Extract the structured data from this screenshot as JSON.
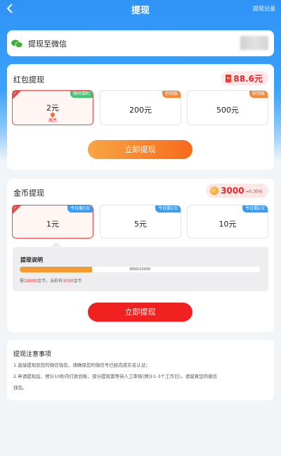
{
  "nav": {
    "title": "提现",
    "record_label": "提现记录"
  },
  "wechat": {
    "label": "提现至微信"
  },
  "red_packet": {
    "title": "红包提现",
    "balance": "88.6元",
    "options": [
      {
        "value": "2元",
        "tag": "限时福利",
        "hint": "高亮",
        "selected": true
      },
      {
        "value": "200元",
        "tag": "秒到账"
      },
      {
        "value": "500元",
        "tag": "秒到账"
      }
    ],
    "button_label": "立即提现"
  },
  "gold": {
    "title": "金币提现",
    "balance": "3000",
    "balance_sub": "≈0.30元",
    "options": [
      {
        "value": "1元",
        "tag": "今日剩3次",
        "selected": true
      },
      {
        "value": "5元",
        "tag": "今日剩2次"
      },
      {
        "value": "10元",
        "tag": "今日剩2次"
      }
    ],
    "note": {
      "title": "提现说明",
      "progress": 0.3,
      "progress_text": "3000/10000",
      "need_prefix": "需",
      "need_amount": "10000",
      "need_mid": "金币，当前有",
      "have_amount": "3030",
      "need_suffix": "金币"
    },
    "button_label": "立即提现"
  },
  "tips": {
    "title": "提现注意事项",
    "lines": [
      "1.直接提现到您的微信钱包，请确保您的微信号已经完成实名认证；",
      "2.申请提现后，预计10秒内打款到账，部分提现需等待人工审核(预计1-3个工作日)，请留意您的微信",
      "钱包。"
    ]
  },
  "colors": {
    "primary_blue": "#2f93f6",
    "accent_red": "#e8262c",
    "orange": "#f76a1c",
    "wechat_green": "#3cb034"
  }
}
